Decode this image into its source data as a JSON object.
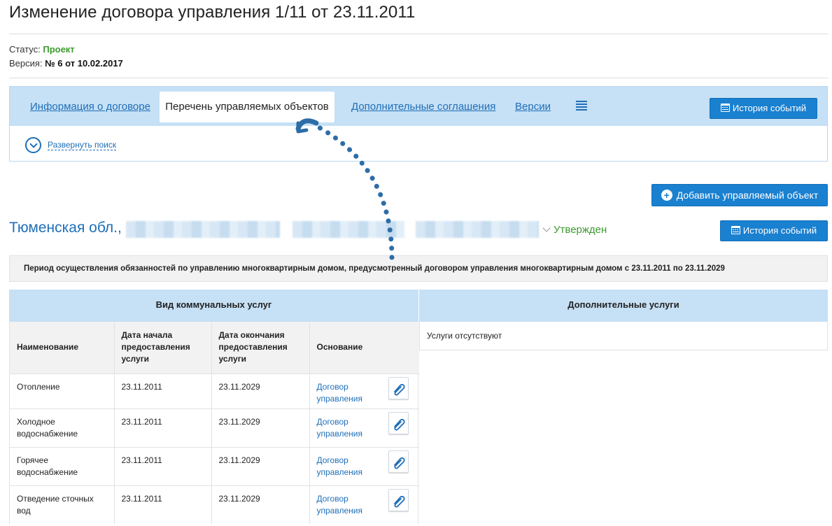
{
  "page": {
    "title": "Изменение договора управления 1/11 от 23.11.2011",
    "status_label": "Статус:",
    "status_value": "Проект",
    "version_label": "Версия:",
    "version_value": "№ 6 от 10.02.2017"
  },
  "tabs": {
    "items": [
      "Информация о договоре",
      "Перечень управляемых объектов",
      "Дополнительные соглашения",
      "Версии"
    ],
    "active_index": 1,
    "history_button": "История событий",
    "expand_search": "Развернуть поиск"
  },
  "object": {
    "add_button": "Добавить управляемый объект",
    "region": "Тюменская обл.,",
    "status": "Утвержден",
    "history_button": "История событий",
    "period_text": "Период осуществления обязанностей по управлению многоквартирным домом, предусмотренный договором управления многоквартирным домом с 23.11.2011 по 23.11.2029"
  },
  "utilities": {
    "header": "Вид коммунальных услуг",
    "columns": [
      "Наименование",
      "Дата начала предоставления услуги",
      "Дата окончания предоставления услуги",
      "Основание"
    ],
    "rows": [
      {
        "name": "Отопление",
        "start": "23.11.2011",
        "end": "23.11.2029",
        "basis": "Договор управления"
      },
      {
        "name": "Холодное водоснабжение",
        "start": "23.11.2011",
        "end": "23.11.2029",
        "basis": "Договор управления"
      },
      {
        "name": "Горячее водоснабжение",
        "start": "23.11.2011",
        "end": "23.11.2029",
        "basis": "Договор управления"
      },
      {
        "name": "Отведение сточных вод",
        "start": "23.11.2011",
        "end": "23.11.2029",
        "basis": "Договор управления"
      }
    ]
  },
  "extra_services": {
    "header": "Дополнительные услуги",
    "empty_text": "Услуги отсутствуют"
  },
  "colors": {
    "accent": "#1f6fb8",
    "button": "#1a80d0",
    "status_green": "#3c9a2f",
    "tab_bar": "#c6e0f5",
    "annotation_arrow": "#2d6da8"
  }
}
